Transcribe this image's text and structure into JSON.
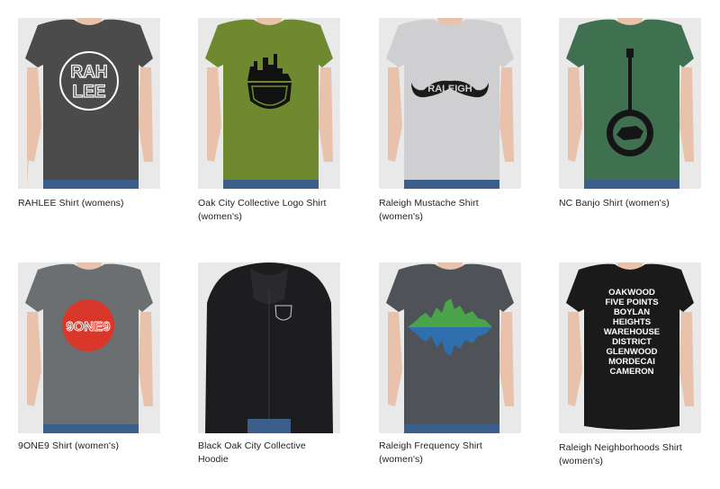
{
  "products": [
    {
      "title_line1": "RAHLEE Shirt (womens)",
      "title_line2": "",
      "shirt_color": "#4b4b4b",
      "print_text": [
        "RAH",
        "LEE"
      ]
    },
    {
      "title_line1": "Oak City Collective Logo Shirt",
      "title_line2": "(women's)",
      "shirt_color": "#6f8a2e"
    },
    {
      "title_line1": "Raleigh Mustache Shirt",
      "title_line2": "(women's)",
      "shirt_color": "#cfcfd1",
      "print_text": [
        "RALEIGH"
      ]
    },
    {
      "title_line1": "NC Banjo Shirt (women's)",
      "title_line2": "",
      "shirt_color": "#3f7150"
    },
    {
      "title_line1": "9ONE9 Shirt (women's)",
      "title_line2": "",
      "shirt_color": "#6c6f71",
      "print_text": [
        "9ONE9"
      ]
    },
    {
      "title_line1": "Black Oak City Collective",
      "title_line2": "Hoodie",
      "shirt_color": "#1d1d1f"
    },
    {
      "title_line1": "Raleigh Frequency Shirt",
      "title_line2": "(women's)",
      "shirt_color": "#4f5357"
    },
    {
      "title_line1": "Raleigh Neighborhoods Shirt",
      "title_line2": "(women's)",
      "shirt_color": "#1a1a1a",
      "print_text": [
        "OAKWOOD",
        "FIVE POINTS",
        "BOYLAN",
        "HEIGHTS",
        "WAREHOUSE",
        "DISTRICT",
        "GLENWOOD",
        "MORDECAI",
        "CAMERON"
      ]
    }
  ],
  "colors": {
    "background": "#ffffff",
    "title_text": "#222222",
    "photo_bg": "#e9e9e9",
    "skin": "#e8c2aa",
    "hair": "#8a5a3a",
    "jeans": "#3b5f8a",
    "print_red": "#d8372a"
  }
}
